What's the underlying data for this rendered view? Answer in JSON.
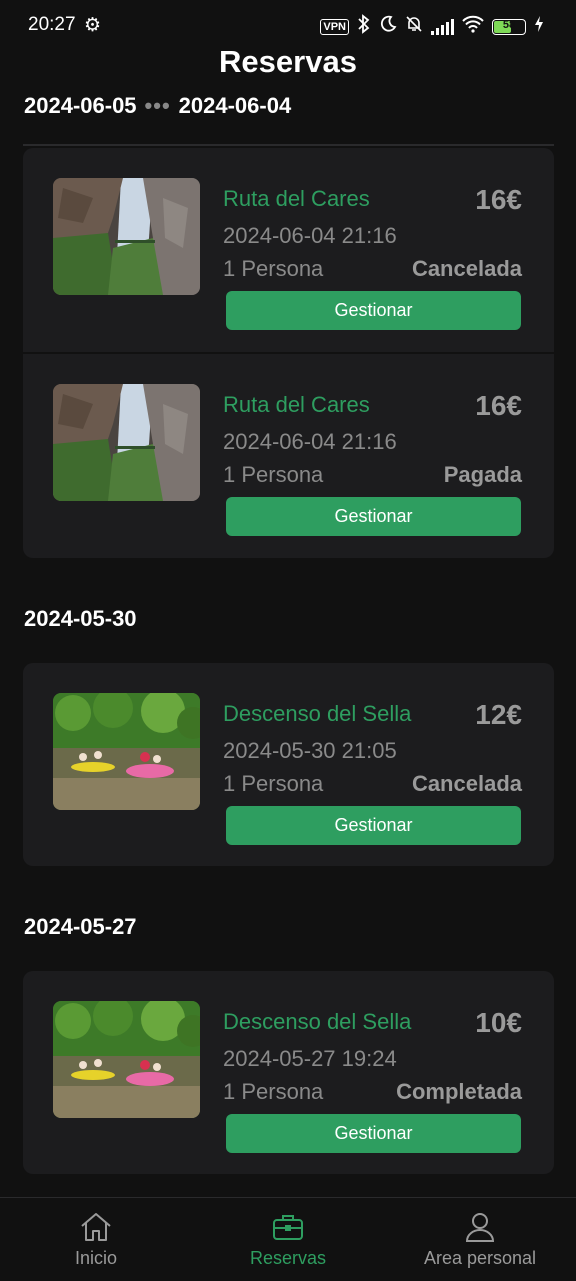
{
  "status_bar": {
    "time": "20:27",
    "vpn": "VPN",
    "battery": "58",
    "battery_level_percent": 58,
    "icons": [
      "settings-gear-icon",
      "vpn-icon",
      "bluetooth-icon",
      "moon-icon",
      "bell-off-icon",
      "signal-icon",
      "wifi-icon",
      "battery-icon",
      "charging-icon"
    ]
  },
  "page": {
    "title": "Reservas"
  },
  "groups": [
    {
      "date_from": "2024-06-05",
      "date_to": "2024-06-04",
      "bookings": [
        {
          "title": "Ruta del Cares",
          "price": "16€",
          "datetime": "2024-06-04 21:16",
          "people": "1 Persona",
          "status": "Cancelada",
          "button": "Gestionar",
          "image": "canyon-trail-photo"
        },
        {
          "title": "Ruta del Cares",
          "price": "16€",
          "datetime": "2024-06-04 21:16",
          "people": "1 Persona",
          "status": "Pagada",
          "button": "Gestionar",
          "image": "canyon-trail-photo"
        }
      ]
    },
    {
      "date": "2024-05-30",
      "bookings": [
        {
          "title": "Descenso del Sella",
          "price": "12€",
          "datetime": "2024-05-30 21:05",
          "people": "1 Persona",
          "status": "Cancelada",
          "button": "Gestionar",
          "image": "river-kayak-photo"
        }
      ]
    },
    {
      "date": "2024-05-27",
      "bookings": [
        {
          "title": "Descenso del Sella",
          "price": "10€",
          "datetime": "2024-05-27 19:24",
          "people": "1 Persona",
          "status": "Completada",
          "button": "Gestionar",
          "image": "river-kayak-photo"
        }
      ]
    }
  ],
  "bottom_nav": {
    "items": [
      {
        "label": "Inicio",
        "icon": "home-icon",
        "active": false
      },
      {
        "label": "Reservas",
        "icon": "briefcase-icon",
        "active": true
      },
      {
        "label": "Area personal",
        "icon": "user-icon",
        "active": false
      }
    ]
  },
  "colors": {
    "accent": "#2e9e60",
    "background": "#111111",
    "card": "#1c1c1e",
    "muted_text": "#8a8a8a"
  }
}
